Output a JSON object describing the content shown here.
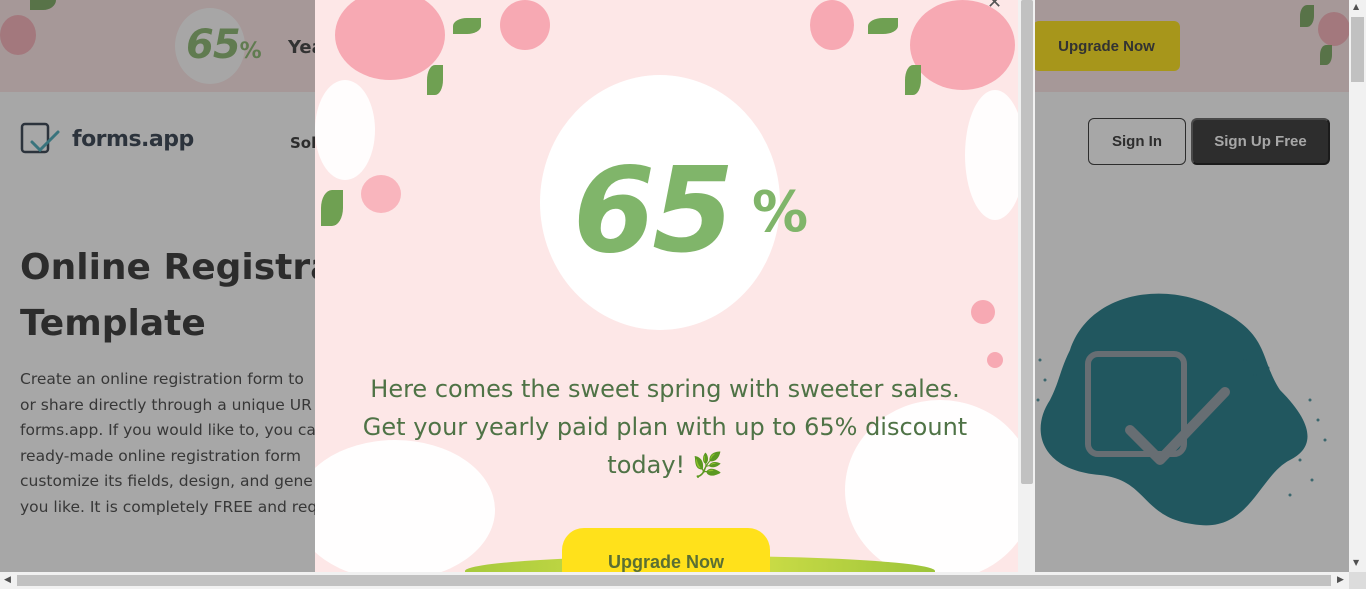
{
  "promo": {
    "discount_number": "65",
    "discount_symbol": "%",
    "text_partial": "Yea",
    "button_label": "Upgrade Now"
  },
  "header": {
    "logo_text": "forms.app",
    "nav_partial": "Sol",
    "sign_in_label": "Sign In",
    "sign_up_label": "Sign Up Free"
  },
  "hero": {
    "title_line1": "Online Registrat",
    "title_line2": "Template",
    "desc_lines": [
      "Create an online registration form to",
      "or share directly through a unique UR",
      "forms.app. If you would like to, you ca",
      "ready-made online registration form",
      "customize its fields, design, and gene",
      "you like. It is completely FREE and requ"
    ]
  },
  "modal": {
    "discount_number": "65",
    "discount_symbol": "%",
    "message": "Here comes the sweet spring with sweeter sales. Get your yearly paid plan with up to 65% discount today!",
    "message_emoji": "🌿",
    "button_label": "Upgrade Now",
    "close_icon": "close-icon"
  },
  "colors": {
    "promo_bg": "#fde4e4",
    "accent_green": "#80b56a",
    "cta_yellow": "#ffe11b",
    "dark_button": "#222222",
    "teal_art": "#0b6d7d"
  }
}
